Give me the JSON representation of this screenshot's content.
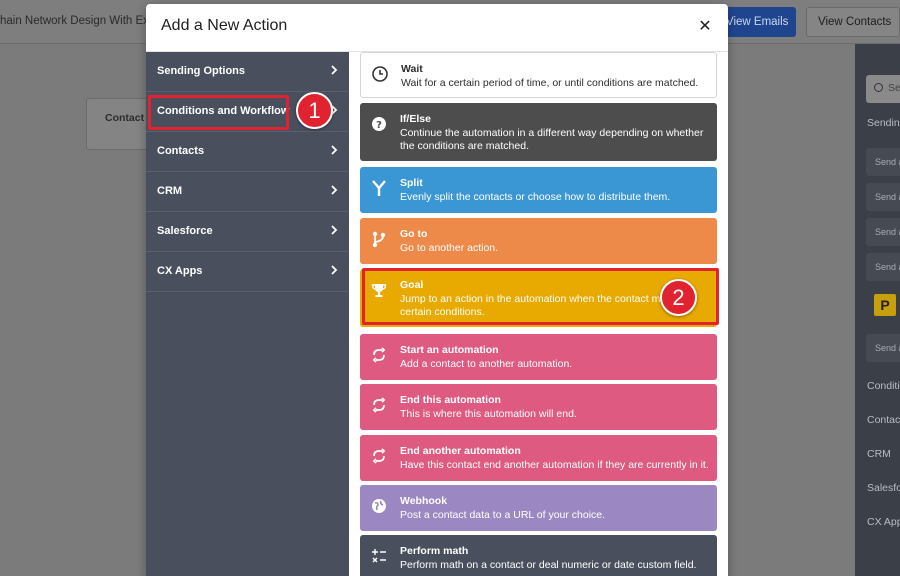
{
  "background": {
    "page_title": "hain Network Design With Excel",
    "buttons": {
      "view_emails": "View Emails",
      "view_contacts": "View Contacts"
    },
    "canvas_card_label": "Contact",
    "right_panel": {
      "search_placeholder": "Se",
      "sections": [
        "Sendin",
        "Conditi",
        "Contac",
        "CRM",
        "Salesfo",
        "CX App"
      ],
      "sub_items": [
        "Send a",
        "Send a",
        "Send a",
        "Send a",
        "Send a"
      ],
      "logo_letter": "P"
    }
  },
  "modal": {
    "title": "Add a New Action",
    "close_label": "✕",
    "categories": [
      {
        "label": "Sending Options"
      },
      {
        "label": "Conditions and Workflow"
      },
      {
        "label": "Contacts"
      },
      {
        "label": "CRM"
      },
      {
        "label": "Salesforce"
      },
      {
        "label": "CX Apps"
      }
    ],
    "actions": [
      {
        "title": "Wait",
        "desc": "Wait for a certain period of time, or until conditions are matched.",
        "color": "#ffffff",
        "icon": "clock-icon"
      },
      {
        "title": "If/Else",
        "desc": "Continue the automation in a different way depending on whether the conditions are matched.",
        "color": "#4d4d4d",
        "icon": "question-icon"
      },
      {
        "title": "Split",
        "desc": "Evenly split the contacts or choose how to distribute them.",
        "color": "#3a97d4",
        "icon": "split-icon"
      },
      {
        "title": "Go to",
        "desc": "Go to another action.",
        "color": "#ee8a49",
        "icon": "branch-icon"
      },
      {
        "title": "Goal",
        "desc": "Jump to an action in the automation when the contact matches certain conditions.",
        "color": "#e8aa00",
        "icon": "trophy-icon"
      },
      {
        "title": "Start an automation",
        "desc": "Add a contact to another automation.",
        "color": "#de5a80",
        "icon": "refresh-icon"
      },
      {
        "title": "End this automation",
        "desc": "This is where this automation will end.",
        "color": "#de5a80",
        "icon": "refresh-icon"
      },
      {
        "title": "End another automation",
        "desc": "Have this contact end another automation if they are currently in it.",
        "color": "#de5a80",
        "icon": "refresh-icon"
      },
      {
        "title": "Webhook",
        "desc": "Post a contact data to a URL of your choice.",
        "color": "#9b87c2",
        "icon": "globe-icon"
      },
      {
        "title": "Perform math",
        "desc": "Perform math on a contact or deal numeric or date custom field.",
        "color": "#4a4f5d",
        "icon": "math-icon"
      }
    ]
  },
  "annotations": {
    "step1": "1",
    "step2": "2",
    "highlight_color": "#e0232e"
  }
}
